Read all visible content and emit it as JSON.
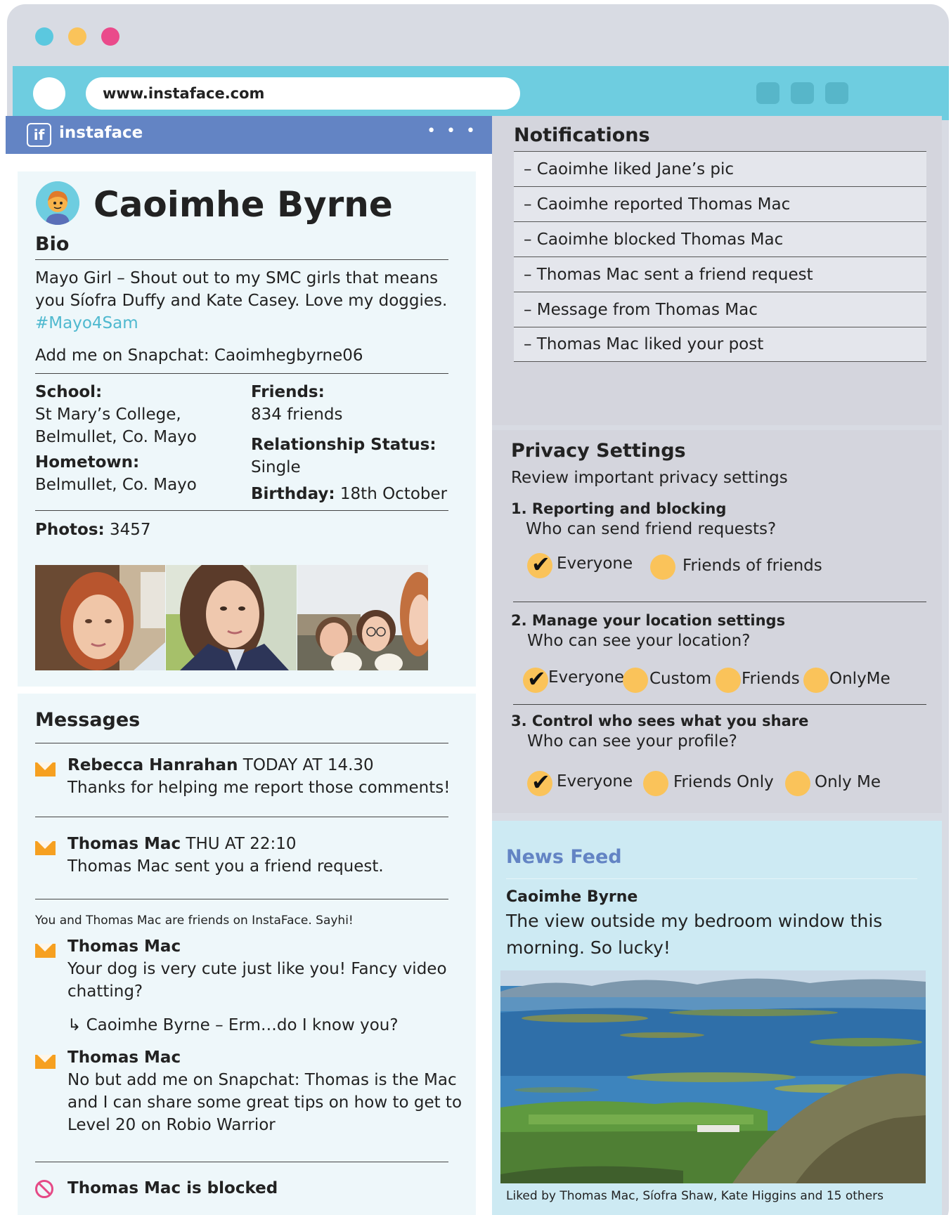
{
  "browser": {
    "url": "www.instaface.com",
    "colors": {
      "dot1": "#5bc8df",
      "dot2": "#fac35a",
      "dot3": "#ea4a8b"
    }
  },
  "site": {
    "logo_text": "if",
    "name": "instaface",
    "more": "• • •"
  },
  "profile": {
    "name": "Caoimhe Byrne",
    "bio_heading": "Bio",
    "bio_line1": "Mayo Girl – Shout out to my SMC girls that means",
    "bio_line2": "you Síofra Duffy and Kate Casey. Love my doggies.",
    "bio_tag": "#Mayo4Sam",
    "snapchat": "Add me on Snapchat: Caoimhegbyrne06",
    "school_label": "School:",
    "school_line1": "St Mary’s College,",
    "school_line2": "Belmullet, Co. Mayo",
    "hometown_label": "Hometown:",
    "hometown_value": "Belmullet, Co. Mayo",
    "friends_label": "Friends:",
    "friends_value": "834 friends",
    "relationship_label": "Relationship Status:",
    "relationship_value": "Single",
    "birthday_label": "Birthday:",
    "birthday_value": "18th October",
    "photos_label": "Photos:",
    "photos_count": "3457"
  },
  "messages": {
    "heading": "Messages",
    "m1_sender": "Rebecca Hanrahan",
    "m1_time": "TODAY AT 14.30",
    "m1_text": "Thanks for helping me report those comments!",
    "m2_sender": "Thomas Mac",
    "m2_time": "THU AT 22:10",
    "m2_text": "Thomas Mac sent you a friend request.",
    "friends_note": "You and Thomas Mac are friends on InstaFace. Sayhi!",
    "m3_sender": "Thomas Mac",
    "m3_line1": "Your dog is very cute just like you! Fancy video",
    "m3_line2": "chatting?",
    "reply": "↳  Caoimhe Byrne – Erm…do I know you?",
    "m4_sender": "Thomas Mac",
    "m4_line1": "No but add me on Snapchat: Thomas is the Mac",
    "m4_line2": "and I can share some great tips on how to get to",
    "m4_line3": "Level 20 on Robio Warrior",
    "blocked": "Thomas Mac is blocked"
  },
  "notifications": {
    "heading": "Notifications",
    "items": [
      "– Caoimhe liked Jane’s pic",
      "– Caoimhe reported Thomas Mac",
      "– Caoimhe blocked Thomas Mac",
      "– Thomas Mac sent a friend request",
      "– Message from Thomas Mac",
      "– Thomas Mac liked your post"
    ]
  },
  "privacy": {
    "heading": "Privacy Settings",
    "subheading": "Review important privacy settings",
    "s1_title": "1. Reporting and blocking",
    "s1_question": "Who can send friend requests?",
    "s1_opt1": "Everyone",
    "s1_opt2": "Friends of friends",
    "s2_title": "2. Manage your location settings",
    "s2_question": "Who can see your location?",
    "s2_opt1": "Everyone",
    "s2_opt2": "Custom",
    "s2_opt3": "Friends",
    "s2_opt4": "OnlyMe",
    "s3_title": "3. Control who sees what you share",
    "s3_question": "Who can see your profile?",
    "s3_opt1": "Everyone",
    "s3_opt2": "Friends Only",
    "s3_opt3": "Only Me",
    "checkmark": "✔"
  },
  "feed": {
    "heading": "News Feed",
    "author": "Caoimhe Byrne",
    "post_line1": "The view outside my bedroom window this",
    "post_line2": "morning. So lucky!",
    "likes": "Liked by Thomas Mac, Síofra Shaw, Kate Higgins and 15 others"
  }
}
